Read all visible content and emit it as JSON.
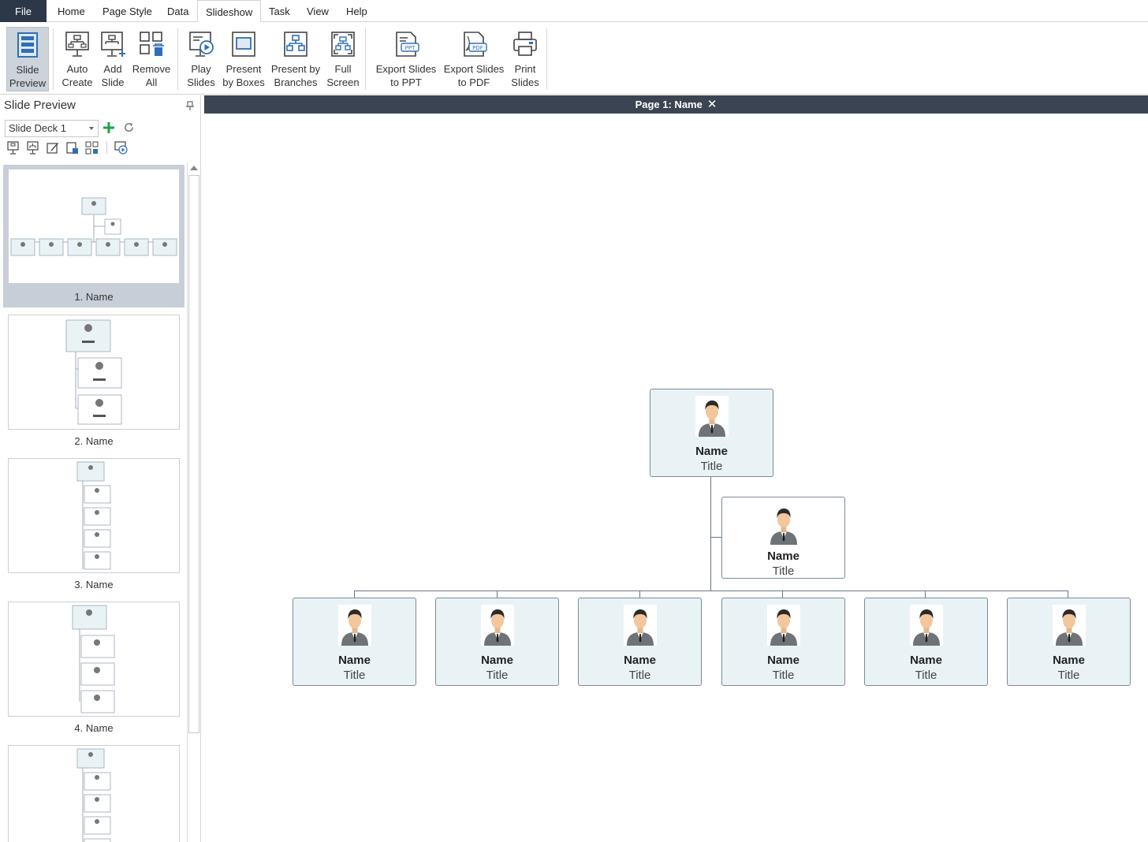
{
  "menu": {
    "items": [
      "File",
      "Home",
      "Page Style",
      "Data",
      "Slideshow",
      "Task",
      "View",
      "Help"
    ],
    "active": "Slideshow"
  },
  "ribbon": {
    "slide_preview": [
      "Slide",
      "Preview"
    ],
    "auto_create": [
      "Auto",
      "Create"
    ],
    "add_slide": [
      "Add",
      "Slide"
    ],
    "remove_all": [
      "Remove",
      "All"
    ],
    "play_slides": [
      "Play",
      "Slides"
    ],
    "present_by_boxes": [
      "Present",
      "by Boxes"
    ],
    "present_by_branches": [
      "Present by",
      "Branches"
    ],
    "full_screen": [
      "Full",
      "Screen"
    ],
    "export_ppt": [
      "Export Slides",
      "to PPT"
    ],
    "export_pdf": [
      "Export Slides",
      "to PDF"
    ],
    "print_slides": [
      "Print",
      "Slides"
    ]
  },
  "panel": {
    "title": "Slide Preview",
    "deck": "Slide Deck 1",
    "slides": [
      "1. Name",
      "2. Name",
      "3. Name",
      "4. Name"
    ]
  },
  "canvas": {
    "tab_title": "Page 1: Name",
    "root": {
      "name": "Name",
      "title": "Title"
    },
    "assistant": {
      "name": "Name",
      "title": "Title"
    },
    "children": [
      {
        "name": "Name",
        "title": "Title"
      },
      {
        "name": "Name",
        "title": "Title"
      },
      {
        "name": "Name",
        "title": "Title"
      },
      {
        "name": "Name",
        "title": "Title"
      },
      {
        "name": "Name",
        "title": "Title"
      },
      {
        "name": "Name",
        "title": "Title"
      }
    ]
  },
  "colors": {
    "file_tab": "#2c3747",
    "canvas_header": "#3b4452",
    "node_fill": "#e9f3f6",
    "node_border": "#7e8a98",
    "icon_blue": "#2f6fb7",
    "add_green": "#1fa24a"
  }
}
